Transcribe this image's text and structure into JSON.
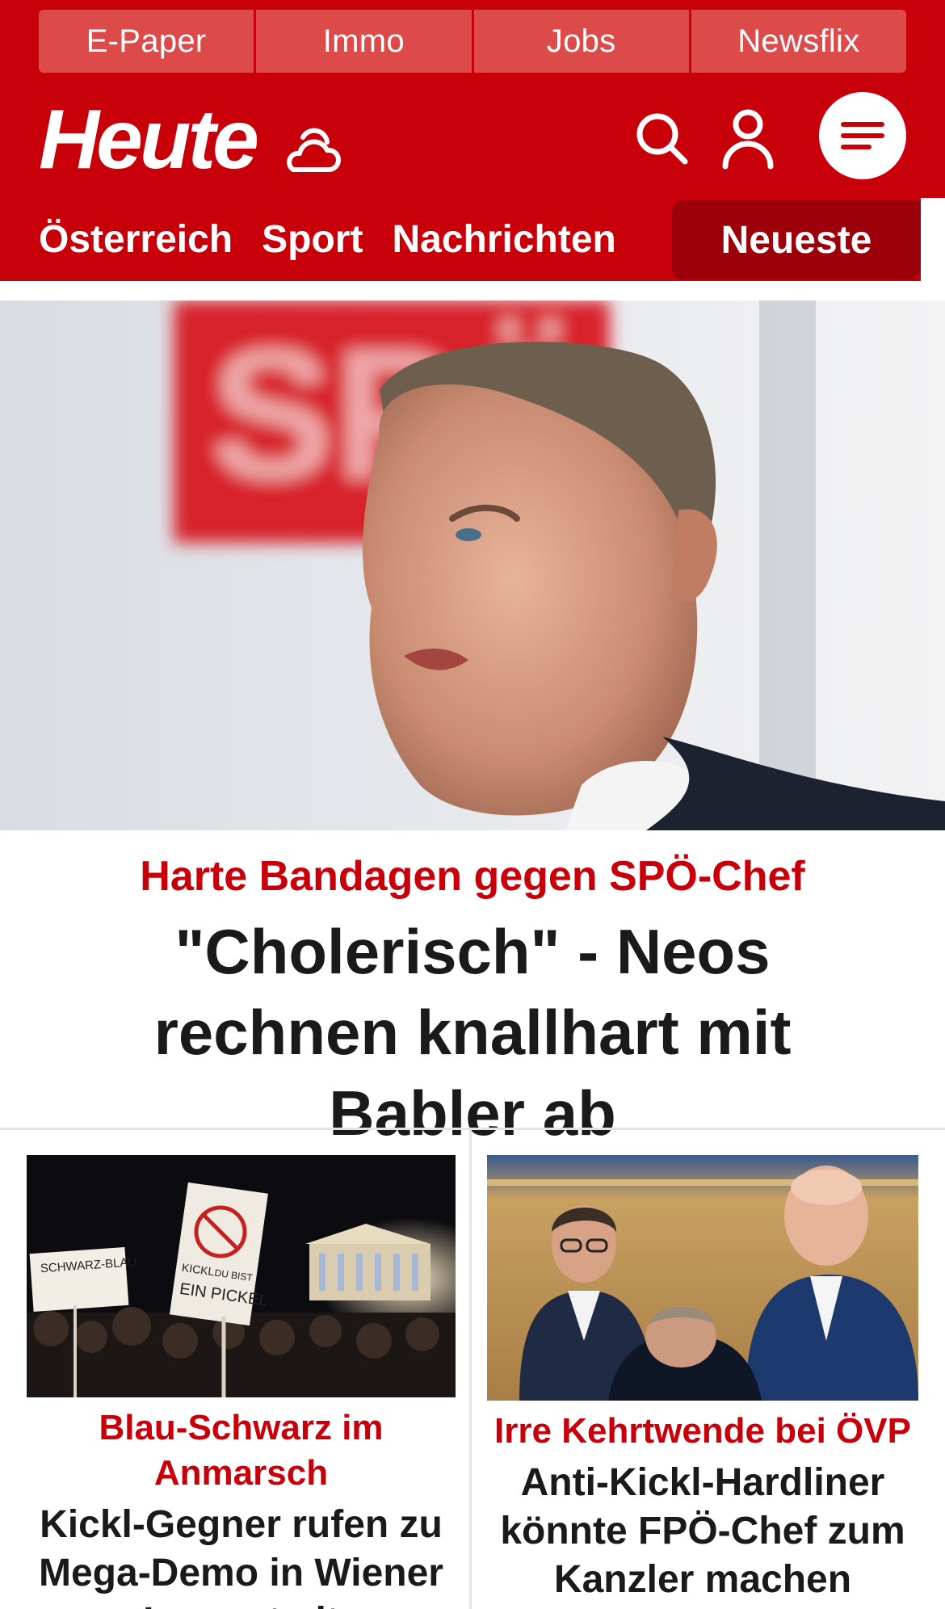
{
  "colors": {
    "brand_red": "#c8000a",
    "dark_red": "#9c0008",
    "link_tab": "#dd4a4a",
    "text_dark": "#1a1a1a"
  },
  "top_links": [
    "E-Paper",
    "Immo",
    "Jobs",
    "Newsflix"
  ],
  "header": {
    "logo_text": "Heute",
    "weather_icon": "cloud-sun-icon",
    "search_icon": "search-icon",
    "account_icon": "user-icon",
    "menu_icon": "menu-icon"
  },
  "nav": {
    "items": [
      "Österreich",
      "Sport",
      "Nachrichten"
    ],
    "active": "Neueste"
  },
  "hero": {
    "image": "Portrait of a man speaking in front of a red SPÖ logo",
    "kicker": "Harte Bandagen gegen SPÖ-Chef",
    "title": "\"Cholerisch\" - Neos rechnen knallhart mit Babler ab"
  },
  "teasers": [
    {
      "image": "Night protest in front of the parliament with hand-drawn signs",
      "sign_texts": [
        "SCHWARZ-BLAU",
        "KICKL",
        "DU BIST",
        "EIN PICKEL"
      ],
      "kicker": "Blau-Schwarz im Anmarsch",
      "title": "Kickl-Gegner rufen zu Mega-Demo in Wiener Innenstadt"
    },
    {
      "image": "Politicians talking in parliament benches",
      "kicker": "Irre Kehrtwende bei ÖVP",
      "title": "Anti-Kickl-Hardliner könnte FPÖ-Chef zum Kanzler machen"
    }
  ]
}
